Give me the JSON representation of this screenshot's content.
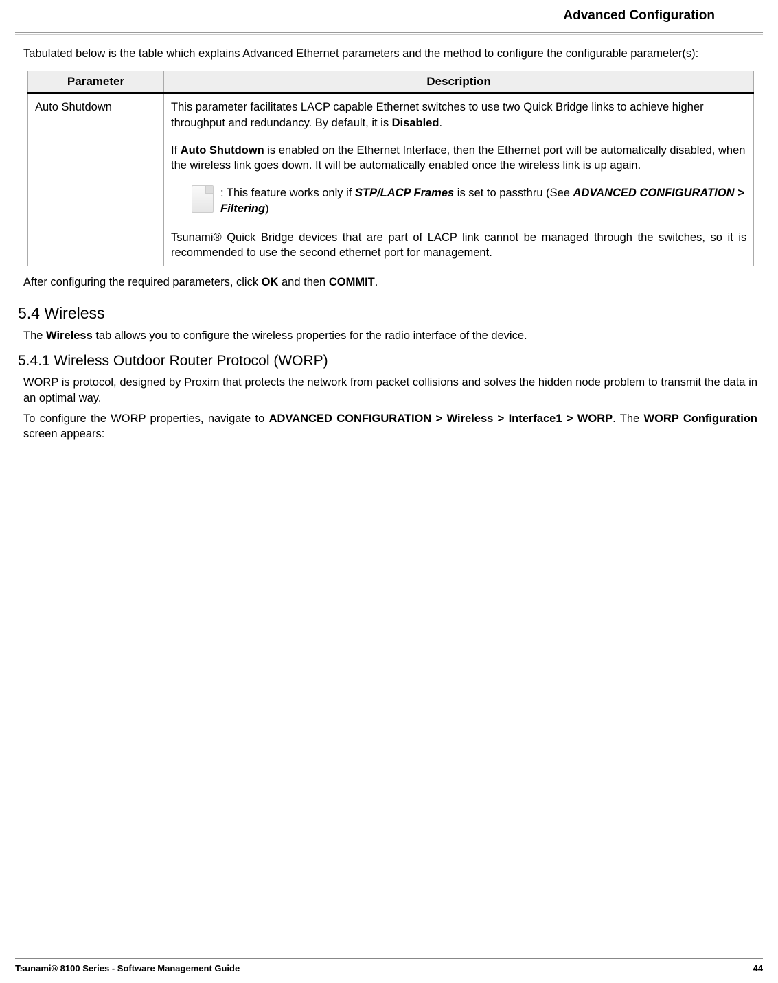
{
  "header": {
    "title": "Advanced Configuration"
  },
  "intro": "Tabulated below is the table which explains Advanced Ethernet parameters and the method to configure the configurable parameter(s):",
  "table": {
    "headers": {
      "parameter": "Parameter",
      "description": "Description"
    },
    "row": {
      "parameter": "Auto Shutdown",
      "desc1a": "This parameter facilitates LACP capable Ethernet switches to use two Quick Bridge links to achieve higher throughput and redundancy. By default, it is ",
      "desc1b": "Disabled",
      "desc1c": ".",
      "desc2a": "If ",
      "desc2b": "Auto Shutdown",
      "desc2c": " is enabled on the Ethernet Interface, then the Ethernet port will be automatically disabled, when the wireless link goes down. It will be automatically enabled once the wireless link is up again.",
      "note_a": ": This feature works only if ",
      "note_b": "STP/LACP Frames",
      "note_c": " is set to passthru (See ",
      "note_d": "ADVANCED CONFIGURATION > Filtering",
      "note_e": ")",
      "desc3": "Tsunami® Quick Bridge devices that are part of LACP link cannot be managed through the switches, so it is recommended to use the second ethernet port for management."
    }
  },
  "after_config": {
    "a": "After configuring the required parameters, click ",
    "b": "OK",
    "c": " and then ",
    "d": "COMMIT",
    "e": "."
  },
  "section_5_4": {
    "heading": "5.4 Wireless",
    "text_a": "The ",
    "text_b": "Wireless",
    "text_c": " tab allows you to configure the wireless properties for the radio interface of the device."
  },
  "section_5_4_1": {
    "heading": "5.4.1 Wireless Outdoor Router Protocol (WORP)",
    "p1": "WORP is protocol, designed by Proxim that protects the network from packet collisions and solves the hidden node problem to transmit the data in an optimal way.",
    "p2_a": "To configure the WORP properties, navigate to ",
    "p2_b": "ADVANCED CONFIGURATION > Wireless > Interface1 > WORP",
    "p2_c": ". The ",
    "p2_d": "WORP Configuration",
    "p2_e": " screen appears:"
  },
  "footer": {
    "left": "Tsunami® 8100 Series - Software Management Guide",
    "right": "44"
  }
}
